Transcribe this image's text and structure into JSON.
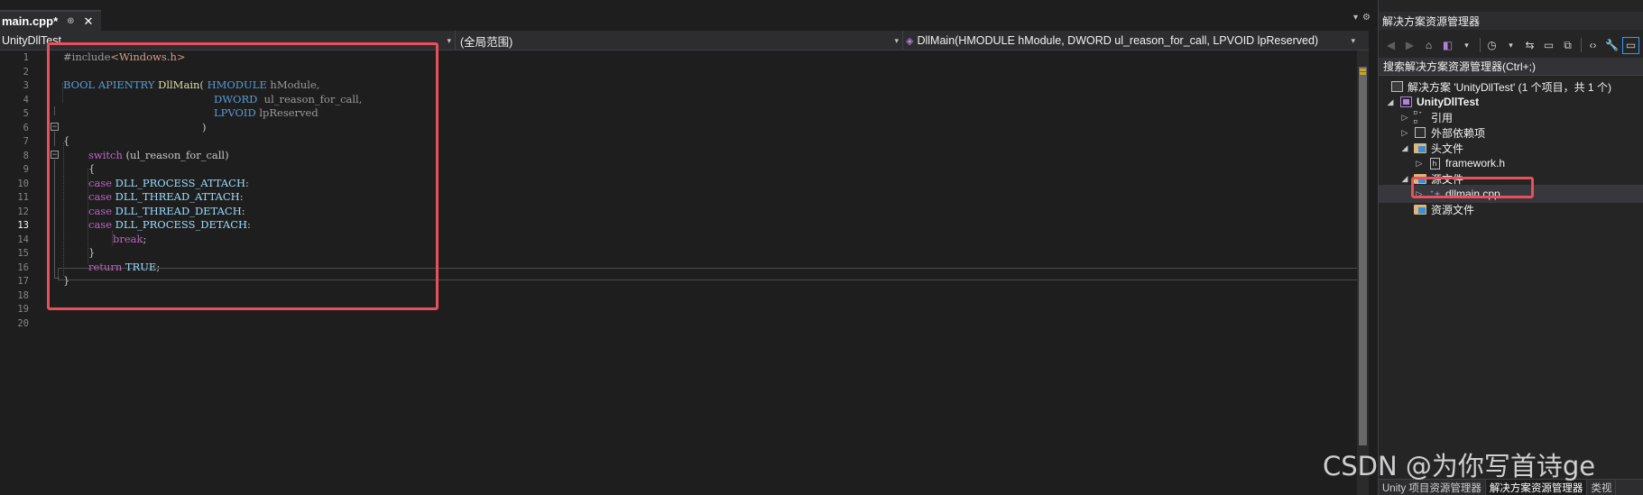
{
  "tab": {
    "title": "main.cpp*",
    "pin": "⊕",
    "close": "✕"
  },
  "tab_strip_icons": {
    "dropdown": "▾",
    "settings": "⚙"
  },
  "navbar": {
    "project": "UnityDllTest",
    "scope": "(全局范围)",
    "function": "DllMain(HMODULE hModule, DWORD ul_reason_for_call, LPVOID lpReserved)"
  },
  "line_numbers": [
    "1",
    "2",
    "3",
    "4",
    "5",
    "6",
    "7",
    "8",
    "9",
    "10",
    "11",
    "12",
    "13",
    "14",
    "15",
    "16",
    "17",
    "18",
    "19",
    "20"
  ],
  "active_line": "13",
  "code": {
    "l1": {
      "pp": "#include",
      "hdr": "<Windows.h>"
    },
    "l3": {
      "t1": "BOOL",
      "t2": "APIENTRY",
      "fn": "DllMain",
      "p1": "(",
      "t3": "HMODULE",
      "a1": "hModule,"
    },
    "l4": {
      "t": "DWORD",
      "a": "ul_reason_for_call,"
    },
    "l5": {
      "t": "LPVOID",
      "a": "lpReserved"
    },
    "l6": {
      "p": ")"
    },
    "l7": {
      "p": "{"
    },
    "l8": {
      "kw": "switch",
      "rest": " (ul_reason_for_call)"
    },
    "l9": {
      "p": "{"
    },
    "l10": {
      "kw": "case",
      "m": "DLL_PROCESS_ATTACH",
      "c": ":"
    },
    "l11": {
      "kw": "case",
      "m": "DLL_THREAD_ATTACH",
      "c": ":"
    },
    "l12": {
      "kw": "case",
      "m": "DLL_THREAD_DETACH",
      "c": ":"
    },
    "l13": {
      "kw": "case",
      "m": "DLL_PROCESS_DETACH",
      "c": ":"
    },
    "l14": {
      "kw": "break",
      "c": ";"
    },
    "l15": {
      "p": "}"
    },
    "l16": {
      "kw": "return",
      "m": "TRUE",
      "c": ";"
    },
    "l17": {
      "p": "}"
    }
  },
  "solution_explorer": {
    "title": "解决方案资源管理器",
    "search_placeholder": "搜索解决方案资源管理器(Ctrl+;)",
    "tree": {
      "solution": "解决方案 'UnityDllTest' (1 个项目，共 1 个)",
      "project": "UnityDllTest",
      "references": "引用",
      "external_deps": "外部依赖项",
      "header_files": "头文件",
      "framework_h": "framework.h",
      "source_files": "源文件",
      "dllmain_cpp": "dllmain.cpp",
      "resource_files": "资源文件"
    },
    "bottom_tabs": [
      "Unity 项目资源管理器",
      "解决方案资源管理器",
      "类视"
    ]
  },
  "watermark": "CSDN @为你写首诗ge",
  "colors": {
    "highlight": "#e8505b",
    "editor_bg": "#1e1e1e",
    "pane_bg": "#252526"
  }
}
